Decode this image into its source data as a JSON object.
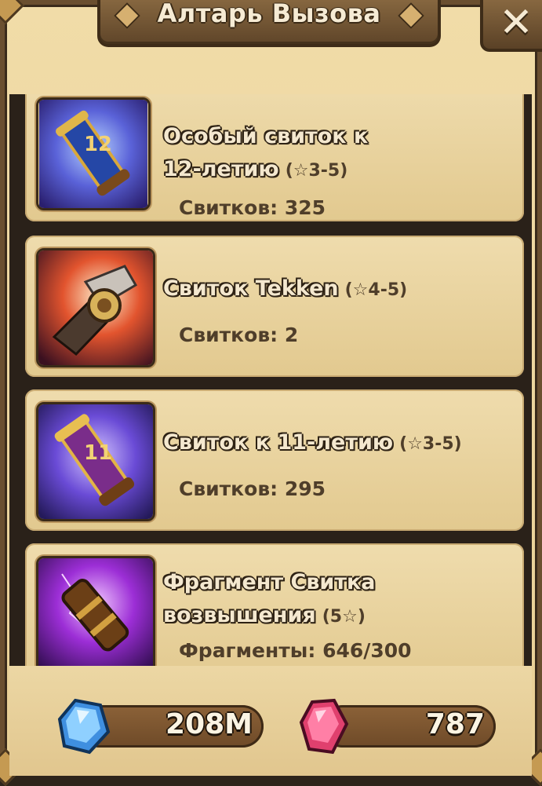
{
  "window": {
    "title": "Алтарь Вызова",
    "close_label": "✕"
  },
  "items": [
    {
      "name_line1": "Особый свиток к",
      "name_line2": "12-летию",
      "stars": "(☆3-5)",
      "count": "Свитков: 325",
      "icon": "scroll-12th-anniversary-icon"
    },
    {
      "name_line1": "Свиток Tekken",
      "stars": "(☆4-5)",
      "count": "Свитков: 2",
      "icon": "tekken-scroll-icon"
    },
    {
      "name_line1": "Свиток к 11-летию",
      "stars": "(☆3-5)",
      "count": "Свитков: 295",
      "icon": "scroll-11th-anniversary-icon"
    },
    {
      "name_line1": "Фрагмент Свитка",
      "name_line2": "возвышения",
      "stars": "(5☆)",
      "count": "Фрагменты: 646/300",
      "icon": "ascension-scroll-fragment-icon"
    }
  ],
  "resources": {
    "crystals": {
      "value": "208M",
      "icon": "blue-crystal-icon",
      "color": "#3f8fe0"
    },
    "gems": {
      "value": "787",
      "icon": "red-gem-icon",
      "color": "#e0406e"
    }
  }
}
